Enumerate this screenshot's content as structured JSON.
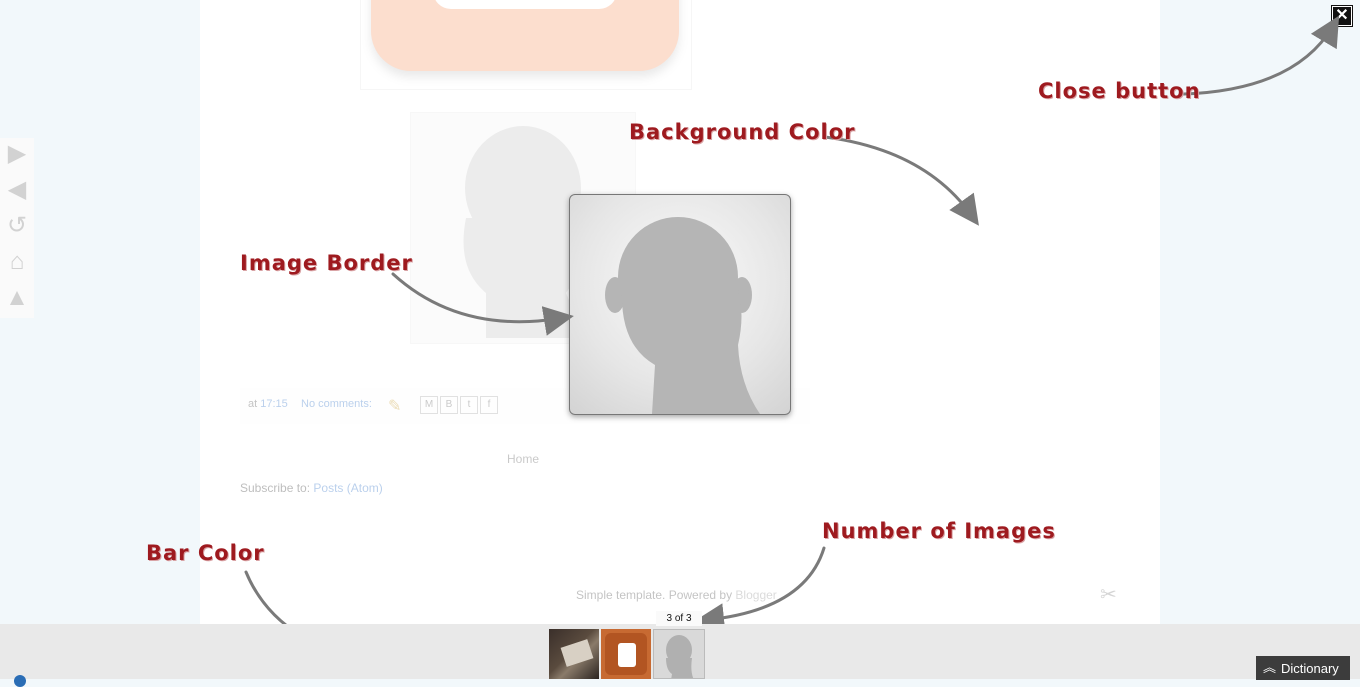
{
  "page": {
    "meta": {
      "at_prefix": "at",
      "time": "17:15",
      "comments": "No comments:",
      "share_icons": [
        "M",
        "B",
        "t",
        "f"
      ]
    },
    "home_link": "Home",
    "subscribe": {
      "prefix": "Subscribe to:",
      "link": "Posts (Atom)"
    },
    "powered": {
      "prefix": "Simple template. Powered by",
      "link": "Blogger"
    }
  },
  "lightbox": {
    "close_label": "✕",
    "counter": "3 of 3",
    "thumbnails": [
      "photo-thumbnail",
      "blogger-logo-thumbnail",
      "avatar-thumbnail"
    ]
  },
  "annotations": {
    "close_button": "Close button",
    "background_color": "Background Color",
    "image_border": "Image Border",
    "bar_color": "Bar Color",
    "number_of_images": "Number of Images"
  },
  "dictionary": {
    "label": "Dictionary",
    "icon": "double-chevron-up-icon"
  },
  "colors": {
    "annotation_text": "#9e1a1f",
    "bar": "#e9e9e9",
    "background": "#f2f8fb",
    "dictionary_button": "#3c3c3c"
  }
}
